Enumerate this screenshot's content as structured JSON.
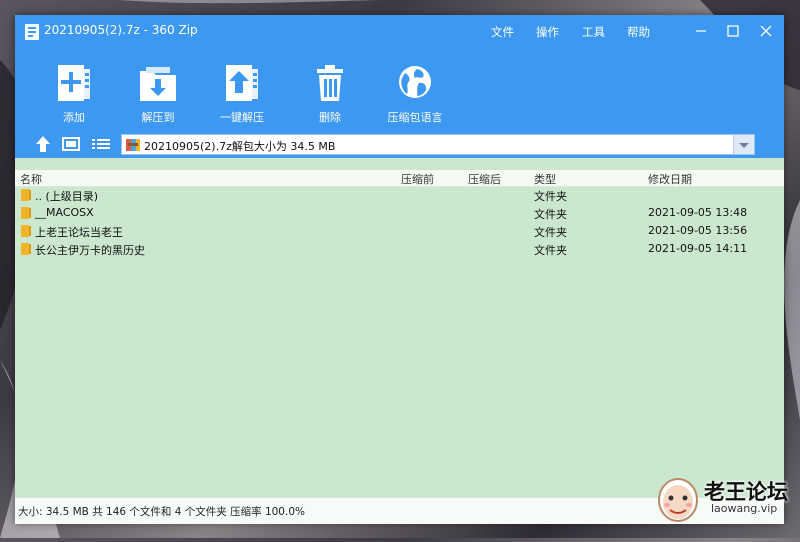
{
  "window": {
    "title": "20210905(2).7z - 360 Zip",
    "menu": [
      "文件",
      "操作",
      "工具",
      "帮助"
    ]
  },
  "toolbar": {
    "add_label": "添加",
    "extract_to_label": "解压到",
    "one_click_label": "一键解压",
    "delete_label": "删除",
    "language_label": "压缩包语言"
  },
  "path": {
    "text": "20210905(2).7z解包大小为 34.5 MB"
  },
  "columns": {
    "name": "名称",
    "before": "压缩前",
    "after": "压缩后",
    "type": "类型",
    "modified": "修改日期"
  },
  "files": [
    {
      "name": ".. (上级目录)",
      "type": "文件夹",
      "modified": ""
    },
    {
      "name": "__MACOSX",
      "type": "文件夹",
      "modified": "2021-09-05 13:48"
    },
    {
      "name": "上老王论坛当老王",
      "type": "文件夹",
      "modified": "2021-09-05 13:56"
    },
    {
      "name": "长公主伊万卡的黑历史",
      "type": "文件夹",
      "modified": "2021-09-05 14:11"
    }
  ],
  "status": {
    "text": "大小: 34.5 MB 共 146 个文件和 4 个文件夹 压缩率 100.0%"
  },
  "watermark": {
    "title": "老王论坛",
    "subtitle": "laowang.vip"
  },
  "colors": {
    "accent": "#3c98f0",
    "list_background": "#cbe8cf",
    "folder": "#f0b429"
  }
}
